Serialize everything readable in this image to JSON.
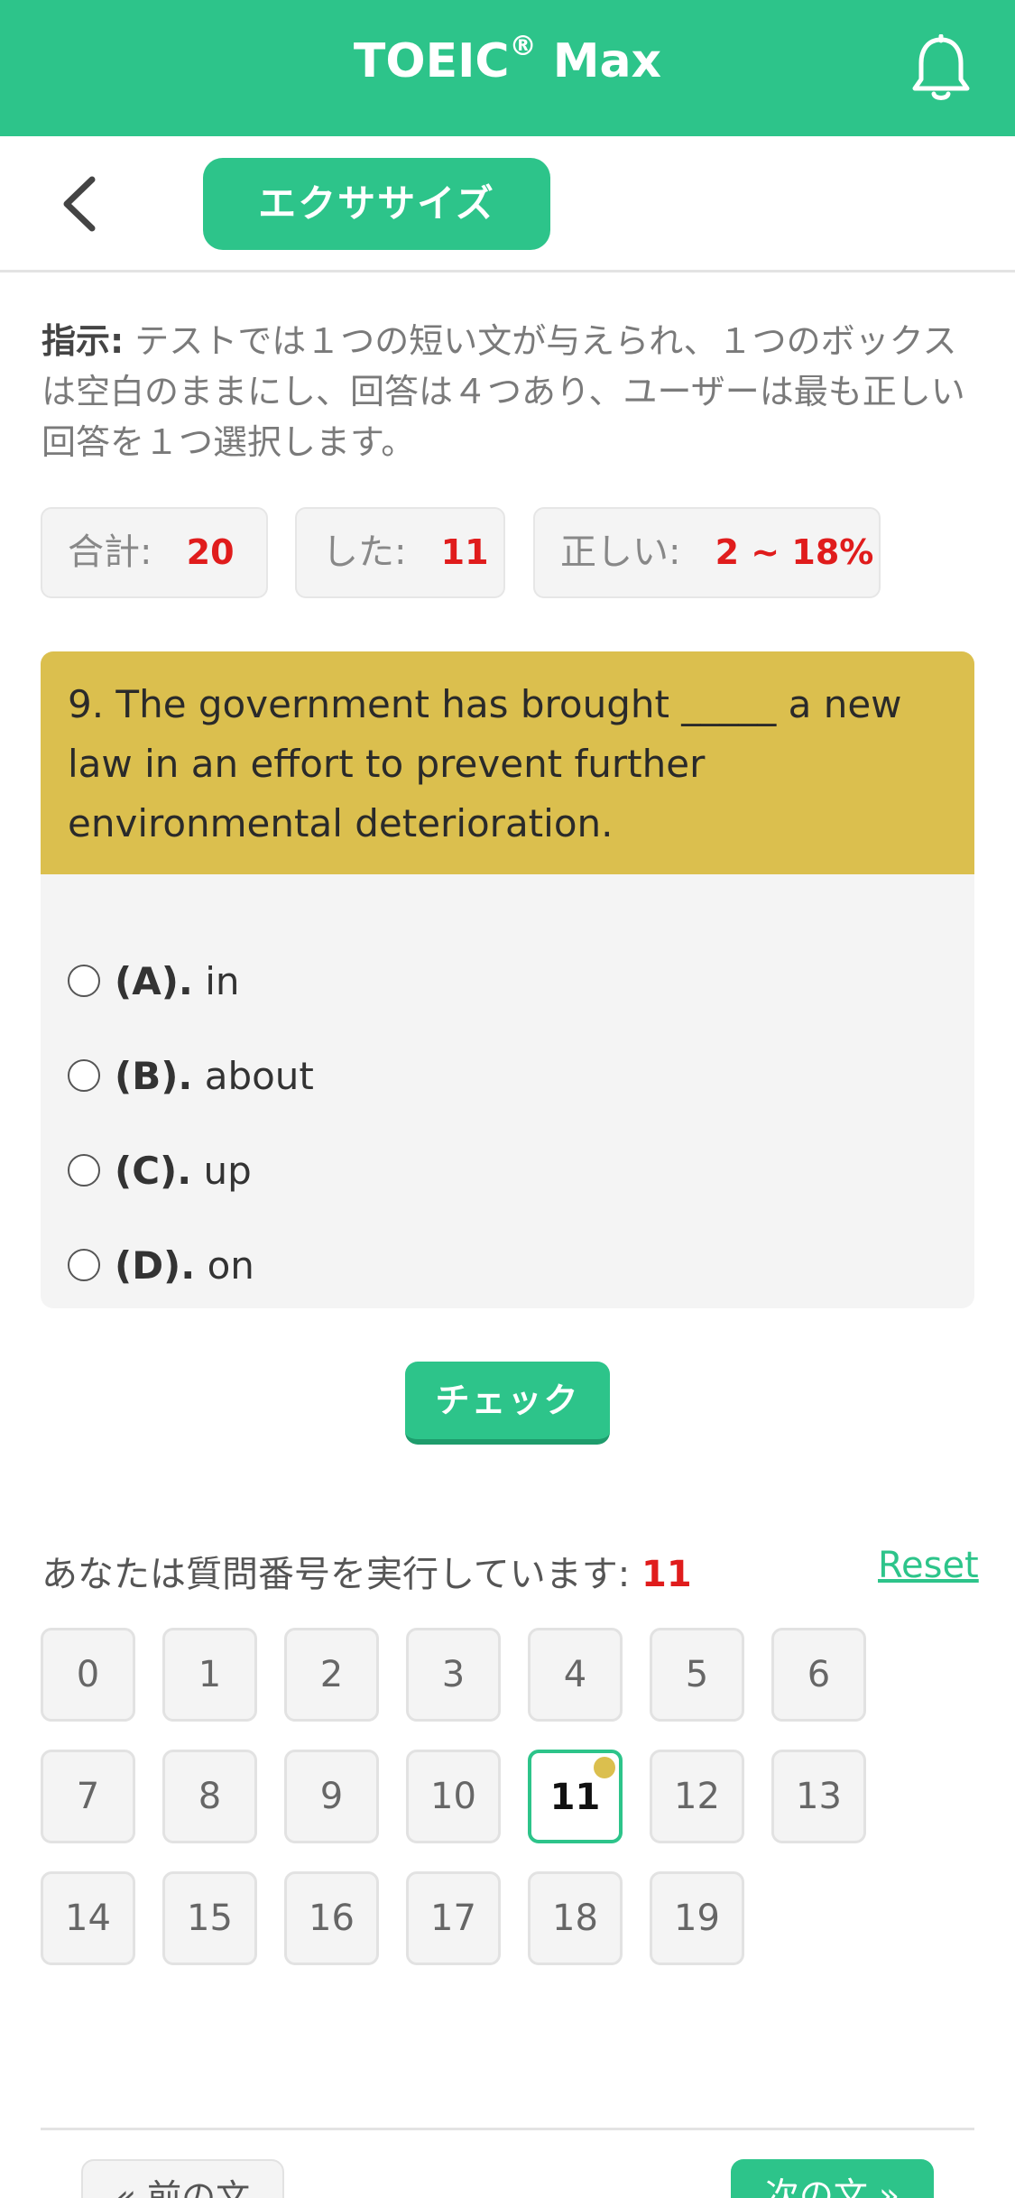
{
  "header": {
    "title": "TOEIC",
    "title_mark": "®",
    "title_suffix": " Max",
    "bell_icon": "bell-icon"
  },
  "subbar": {
    "back_icon": "chevron-left-icon",
    "section_label": "エクササイズ"
  },
  "instructions": {
    "label": "指示:",
    "text": " テストでは１つの短い文が与えられ、１つのボックスは空白のままにし、回答は４つあり、ユーザーは最も正しい回答を１つ選択します。"
  },
  "stats": {
    "total_label": "合計: ",
    "total_value": "20",
    "done_label": "した: ",
    "done_value": "11",
    "correct_label": "正しい: ",
    "correct_value": "2 ~ 18%"
  },
  "question": {
    "text": "9. The government has brought _____ a new law in an effort to prevent further environmental deterioration.",
    "options": [
      {
        "key": "(A).",
        "text": " in"
      },
      {
        "key": "(B).",
        "text": " about"
      },
      {
        "key": "(C).",
        "text": " up"
      },
      {
        "key": "(D).",
        "text": " on"
      }
    ]
  },
  "check_label": "チェック",
  "progress": {
    "running_label": "あなたは質問番号を実行しています: ",
    "running_number": "11",
    "reset_label": "Reset",
    "numbers": [
      "0",
      "1",
      "2",
      "3",
      "4",
      "5",
      "6",
      "7",
      "8",
      "9",
      "10",
      "11",
      "12",
      "13",
      "14",
      "15",
      "16",
      "17",
      "18",
      "19"
    ],
    "current": "11"
  },
  "nav": {
    "prev_label": "« 前の文",
    "next_label": "次の文 »"
  },
  "colors": {
    "brand": "#2dc48a",
    "question_bg": "#dbbf4e",
    "accent_red": "#e01c1c"
  }
}
